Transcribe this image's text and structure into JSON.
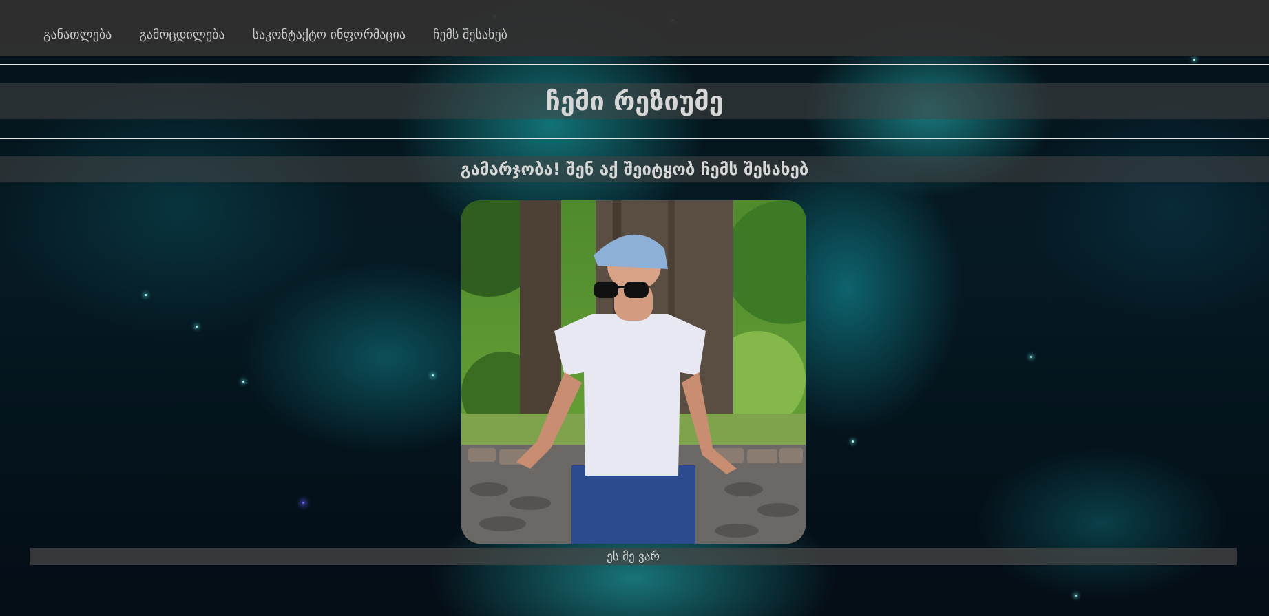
{
  "nav": {
    "items": [
      {
        "label": "განათლება"
      },
      {
        "label": "გამოცდილება"
      },
      {
        "label": "საკონტაქტო ინფორმაცია"
      },
      {
        "label": "ჩემს შესახებ"
      }
    ]
  },
  "header": {
    "title": "ჩემი რეზიუმე",
    "subtitle": "გამარჯობა! შენ აქ შეიტყობ ჩემს შესახებ"
  },
  "profile": {
    "photo_icon": "profile-photo",
    "caption": "ეს მე ვარ"
  },
  "theme": {
    "nav_bg": "#303030",
    "text_color": "#d6d6d6",
    "band_color": "rgba(70,70,70,0.55)",
    "background": "teal nebula space"
  }
}
